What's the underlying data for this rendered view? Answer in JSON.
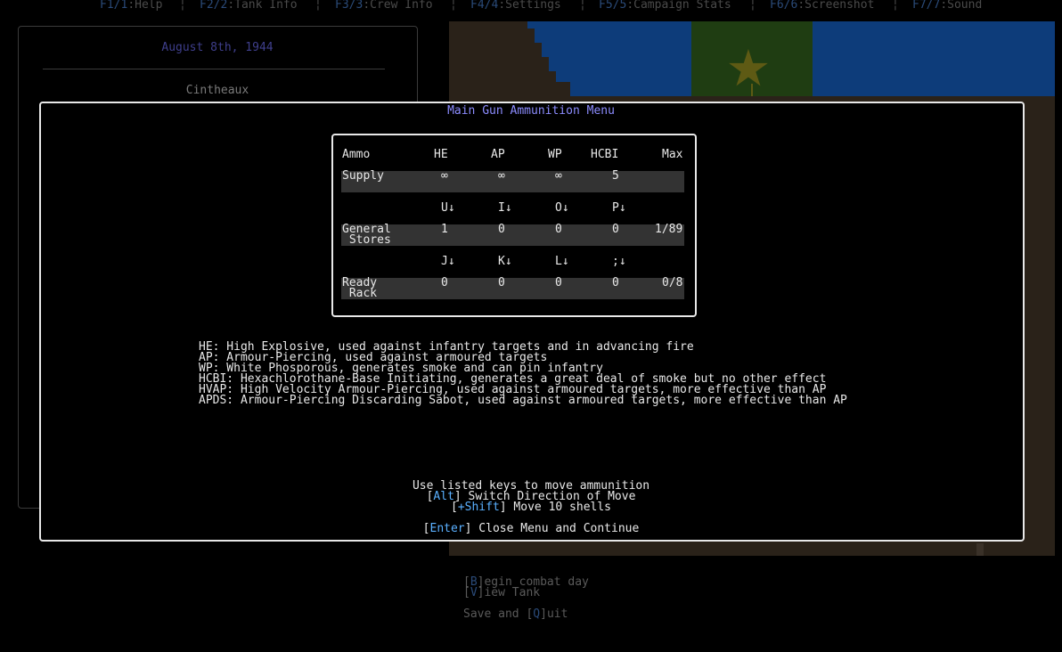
{
  "fkeys": [
    {
      "key": "F1/1",
      "label": ":Help"
    },
    {
      "key": "F2/2",
      "label": ":Tank Info"
    },
    {
      "key": "F3/3",
      "label": ":Crew Info"
    },
    {
      "key": "F4/4",
      "label": ":Settings"
    },
    {
      "key": "F5/5",
      "label": ":Campaign Stats"
    },
    {
      "key": "F6/6",
      "label": ":Screenshot"
    },
    {
      "key": "F7/7",
      "label": ":Sound"
    }
  ],
  "background": {
    "date": "August 8th, 1944",
    "location": "Cintheaux",
    "menu": {
      "begin_key": "B",
      "begin_rest": "egin combat day",
      "view_key": "V",
      "view_rest": "iew Tank",
      "quit_pre": "Save and [",
      "quit_key": "Q",
      "quit_rest": "uit"
    }
  },
  "modal": {
    "title": "Main Gun Ammunition Menu",
    "table": {
      "headers": [
        "Ammo",
        "HE",
        "AP",
        "WP",
        "HCBI",
        "Max"
      ],
      "supply": {
        "label": "Supply",
        "values": [
          "∞",
          "∞",
          "∞",
          "5"
        ],
        "max": ""
      },
      "general_keys": [
        "U↓",
        "I↓",
        "O↓",
        "P↓"
      ],
      "general": {
        "label_1": "General",
        "label_2": " Stores",
        "values": [
          "1",
          "0",
          "0",
          "0"
        ],
        "max": "1/89"
      },
      "ready_keys": [
        "J↓",
        "K↓",
        "L↓",
        ";↓"
      ],
      "ready": {
        "label_1": "Ready",
        "label_2": " Rack",
        "values": [
          "0",
          "0",
          "0",
          "0"
        ],
        "max": "0/8"
      }
    },
    "descriptions": [
      "HE: High Explosive, used against infantry targets and in advancing fire",
      "AP: Armour-Piercing, used against armoured targets",
      "WP: White Phosporous, generates smoke and can pin infantry",
      "HCBI: Hexachlorothane-Base Initiating, generates a great deal of smoke but no other effect",
      "HVAP: High Velocity Armour-Piercing, used against armoured targets, more effective than AP",
      "APDS: Armour-Piercing Discarding Sabot, used against armoured targets, more effective than AP"
    ],
    "instructions": {
      "line1": "Use listed keys to move ammunition",
      "alt_key": "Alt",
      "alt_text": "] Switch Direction of Move",
      "shift_key": "+Shift",
      "shift_text": "] Move 10 shells",
      "enter_key": "Enter",
      "enter_text": "] Close Menu and Continue"
    }
  },
  "colors": {
    "title": "#8c8cff",
    "key_highlight": "#5ab0ff",
    "row_shade": "#333333",
    "map_sea": "#0d3c7a",
    "map_land": "#2a2219"
  }
}
